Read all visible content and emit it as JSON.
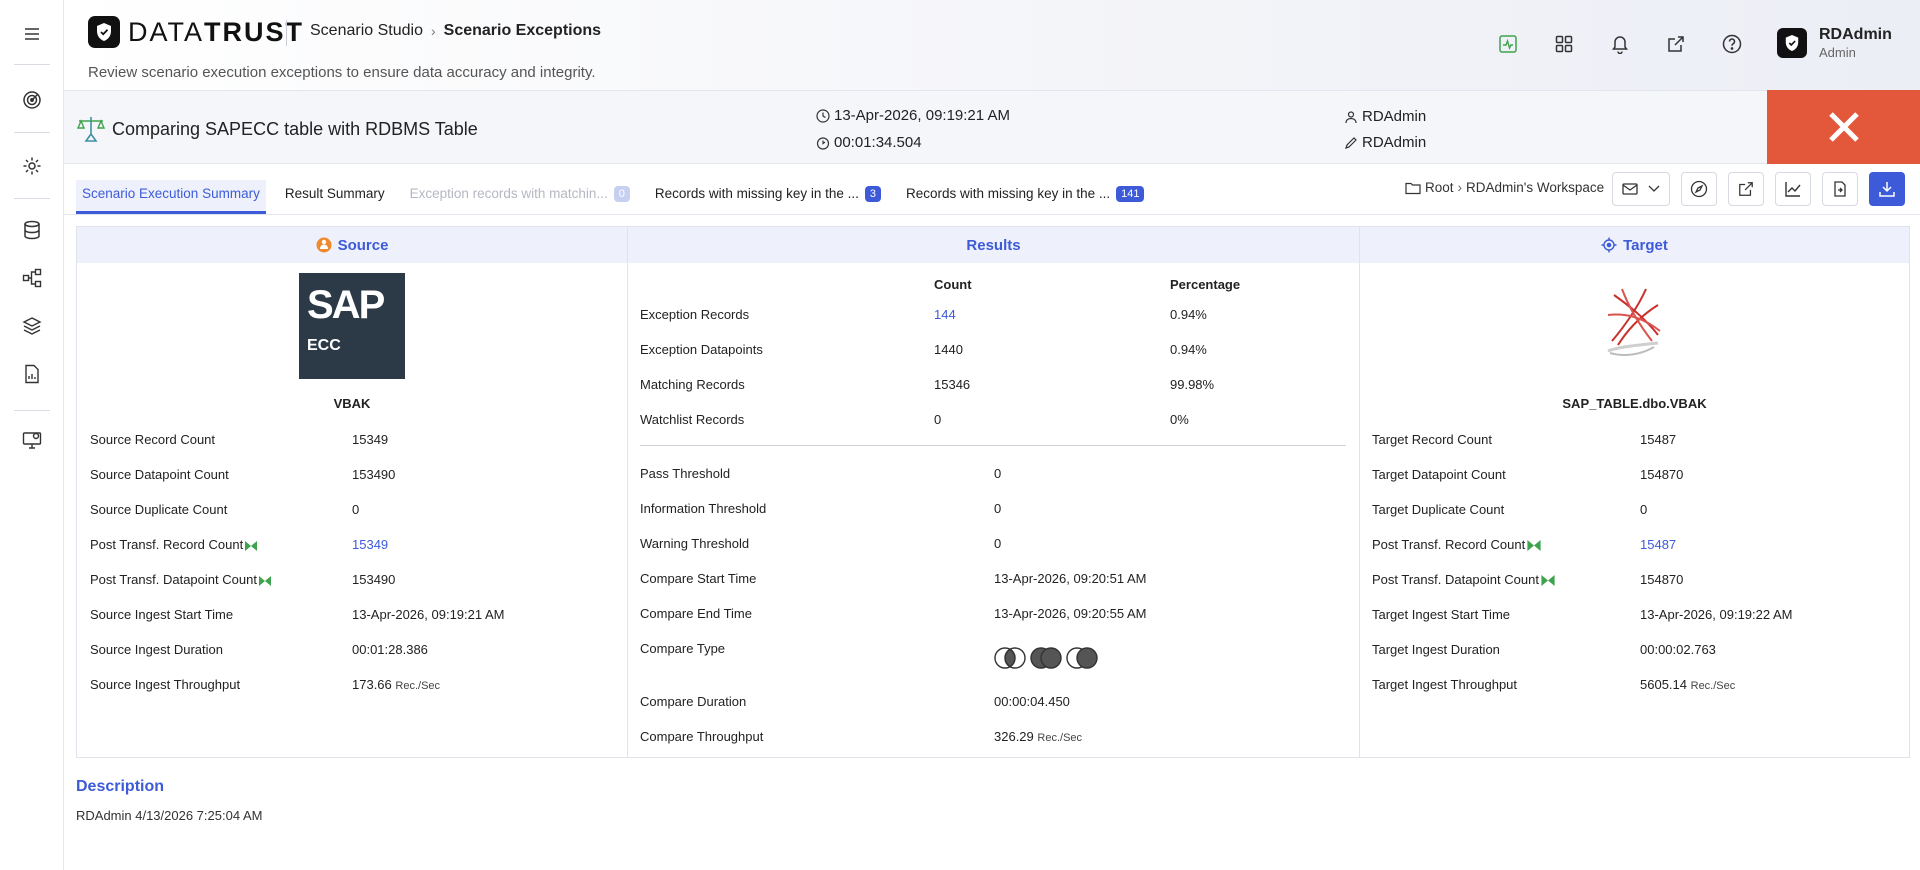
{
  "app": {
    "brand_light": "DATA",
    "brand_bold": "TRUST",
    "subtitle": "Review scenario execution exceptions to ensure data accuracy and integrity."
  },
  "breadcrumb": {
    "parent": "Scenario Studio",
    "current": "Scenario Exceptions"
  },
  "user": {
    "name": "RDAdmin",
    "role": "Admin"
  },
  "scenario": {
    "title": "Comparing SAPECC table with RDBMS Table",
    "run_datetime": "13-Apr-2026, 09:19:21 AM",
    "duration": "00:01:34.504",
    "owner": "RDAdmin",
    "editor": "RDAdmin"
  },
  "tabs": [
    {
      "label": "Scenario Execution Summary"
    },
    {
      "label": "Result Summary"
    },
    {
      "label": "Exception records with matchin...",
      "badge": "0"
    },
    {
      "label": "Records with missing key in the ...",
      "badge": "3"
    },
    {
      "label": "Records with missing key in the ...",
      "badge": "141"
    }
  ],
  "workspace": {
    "root": "Root",
    "name": "RDAdmin's Workspace"
  },
  "source": {
    "header": "Source",
    "logo_text": "SAP",
    "logo_sub": "ECC",
    "table": "VBAK",
    "rows": [
      {
        "label": "Source Record Count",
        "value": "15349"
      },
      {
        "label": "Source Datapoint Count",
        "value": "153490"
      },
      {
        "label": "Source Duplicate Count",
        "value": "0"
      },
      {
        "label": "Post Transf. Record Count",
        "value": "15349"
      },
      {
        "label": "Post Transf. Datapoint Count",
        "value": "153490"
      },
      {
        "label": "Source Ingest Start Time",
        "value": "13-Apr-2026, 09:19:21 AM"
      },
      {
        "label": "Source Ingest Duration",
        "value": "00:01:28.386"
      },
      {
        "label": "Source Ingest Throughput",
        "value": "173.66",
        "unit": "Rec./Sec"
      }
    ]
  },
  "results": {
    "header": "Results",
    "col_count": "Count",
    "col_pct": "Percentage",
    "rows": [
      {
        "label": "Exception Records",
        "count": "144",
        "pct": "0.94%"
      },
      {
        "label": "Exception Datapoints",
        "count": "1440",
        "pct": "0.94%"
      },
      {
        "label": "Matching Records",
        "count": "15346",
        "pct": "99.98%"
      },
      {
        "label": "Watchlist Records",
        "count": "0",
        "pct": "0%"
      }
    ],
    "details": [
      {
        "label": "Pass Threshold",
        "value": "0"
      },
      {
        "label": "Information Threshold",
        "value": "0"
      },
      {
        "label": "Warning Threshold",
        "value": "0"
      },
      {
        "label": "Compare Start Time",
        "value": "13-Apr-2026, 09:20:51 AM"
      },
      {
        "label": "Compare End Time",
        "value": "13-Apr-2026, 09:20:55 AM"
      },
      {
        "label": "Compare Type",
        "value": ""
      },
      {
        "label": "Compare Duration",
        "value": "00:00:04.450"
      },
      {
        "label": "Compare Throughput",
        "value": "326.29",
        "unit": "Rec./Sec"
      }
    ]
  },
  "target": {
    "header": "Target",
    "table": "SAP_TABLE.dbo.VBAK",
    "rows": [
      {
        "label": "Target Record Count",
        "value": "15487"
      },
      {
        "label": "Target Datapoint Count",
        "value": "154870"
      },
      {
        "label": "Target Duplicate Count",
        "value": "0"
      },
      {
        "label": "Post Transf. Record Count",
        "value": "15487"
      },
      {
        "label": "Post Transf. Datapoint Count",
        "value": "154870"
      },
      {
        "label": "Target Ingest Start Time",
        "value": "13-Apr-2026, 09:19:22 AM"
      },
      {
        "label": "Target Ingest Duration",
        "value": "00:00:02.763"
      },
      {
        "label": "Target Ingest Throughput",
        "value": "5605.14",
        "unit": "Rec./Sec"
      }
    ]
  },
  "description": {
    "title": "Description",
    "text": "RDAdmin 4/13/2026 7:25:04 AM"
  },
  "colors": {
    "accent": "#3d5bd9",
    "close": "#e3583a",
    "flag": "#3fa34d"
  },
  "icons": {
    "rail": [
      "menu-icon",
      "target-icon",
      "settings-icon",
      "database-icon",
      "flow-icon",
      "layers-icon",
      "report-icon",
      "monitor-icon"
    ],
    "header": [
      "activity-icon",
      "grid-icon",
      "bell-icon",
      "external-link-icon",
      "help-icon"
    ]
  }
}
